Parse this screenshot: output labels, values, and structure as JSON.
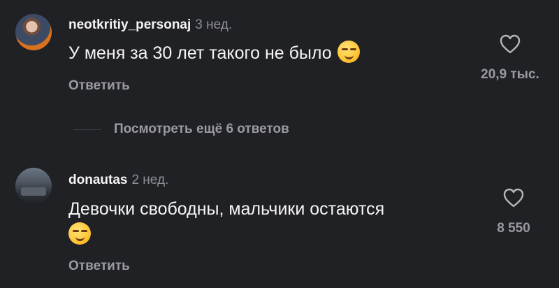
{
  "comments": [
    {
      "username": "neotkritiy_personaj",
      "time": "3 нед.",
      "text": "У меня за 30 лет такого не было",
      "emoji": "smirking-face",
      "reply_label": "Ответить",
      "likes": "20,9 тыс."
    },
    {
      "username": "donautas",
      "time": "2 нед.",
      "text": "Девочки свободны, мальчики остаются",
      "emoji": "smirking-face",
      "reply_label": "Ответить",
      "likes": "8 550"
    }
  ],
  "view_more_replies": "Посмотреть ещё 6 ответов",
  "colors": {
    "background": "#202125",
    "primary_text": "#f5f5f7",
    "secondary_text": "#9a9aa0"
  }
}
